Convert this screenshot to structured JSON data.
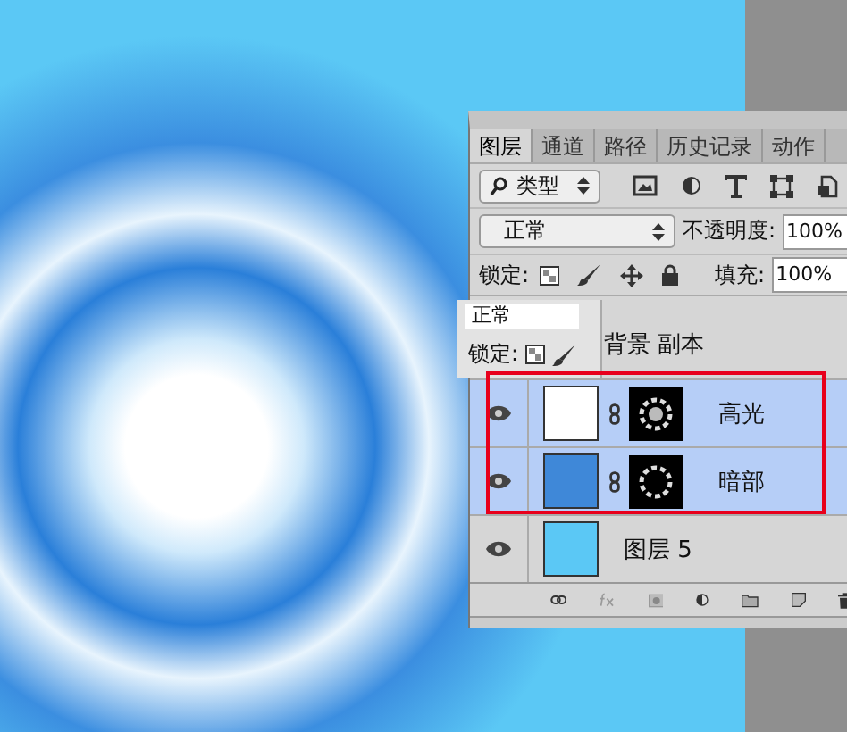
{
  "tabs": [
    {
      "label": "图层",
      "selected": true
    },
    {
      "label": "通道",
      "selected": false
    },
    {
      "label": "路径",
      "selected": false
    },
    {
      "label": "历史记录",
      "selected": false
    },
    {
      "label": "动作",
      "selected": false
    }
  ],
  "filter": {
    "value": "类型"
  },
  "blend_mode": {
    "value": "正常"
  },
  "opacity": {
    "label": "不透明度:",
    "value": "100%"
  },
  "lock": {
    "label": "锁定:"
  },
  "fill": {
    "label": "填充:",
    "value": "100%"
  },
  "overlay_fragment": {
    "blend_mode": "正常",
    "lock_label": "锁定:",
    "layer_name": "背景 副本"
  },
  "layers": [
    {
      "name": "高光",
      "selected": true,
      "visible": true,
      "color": "#ffffff",
      "has_mask": true
    },
    {
      "name": "暗部",
      "selected": true,
      "visible": true,
      "color": "#3f88d8",
      "has_mask": true
    },
    {
      "name": "图层 5",
      "selected": false,
      "visible": true,
      "color": "#5bc8f5",
      "has_mask": false
    }
  ]
}
